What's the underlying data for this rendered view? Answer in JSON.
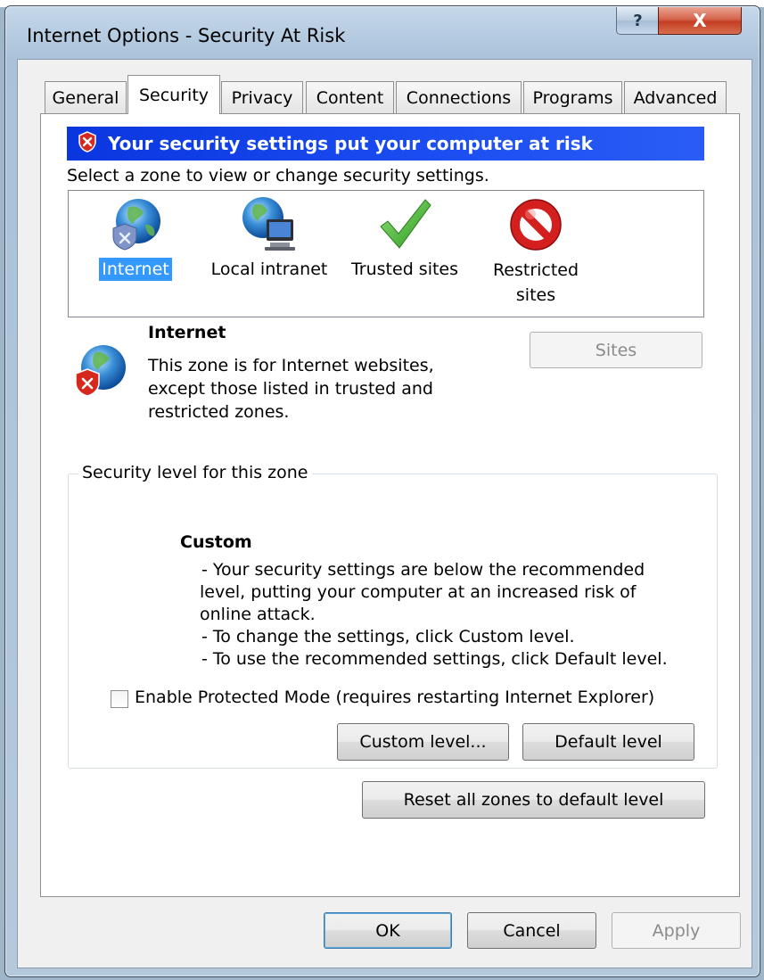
{
  "window": {
    "title": "Internet Options - Security At Risk",
    "help_glyph": "?",
    "close_glyph": "X"
  },
  "tabs": [
    {
      "label": "General"
    },
    {
      "label": "Security"
    },
    {
      "label": "Privacy"
    },
    {
      "label": "Content"
    },
    {
      "label": "Connections"
    },
    {
      "label": "Programs"
    },
    {
      "label": "Advanced"
    }
  ],
  "active_tab": "Security",
  "banner": {
    "text": "Your security settings put your computer at risk"
  },
  "zone_prompt": "Select a zone to view or change security settings.",
  "zones": [
    {
      "label": "Internet",
      "icon": "globe-shield-icon",
      "selected": true
    },
    {
      "label": "Local intranet",
      "icon": "globe-computer-icon",
      "selected": false
    },
    {
      "label": "Trusted sites",
      "icon": "green-check-icon",
      "selected": false
    },
    {
      "label": "Restricted",
      "label2": "sites",
      "icon": "no-entry-icon",
      "selected": false
    }
  ],
  "selected_zone": {
    "name": "Internet",
    "desc1": "This zone is for Internet websites,",
    "desc2": "except those listed in trusted and",
    "desc3": "restricted zones."
  },
  "sites_button": "Sites",
  "security_level": {
    "group_label": "Security level for this zone",
    "level": "Custom",
    "lines": [
      "- Your security settings are below the recommended",
      "level, putting your computer at an increased risk of",
      "online attack.",
      "- To change the settings, click Custom level.",
      "- To use the recommended settings, click Default level."
    ]
  },
  "protected_mode": {
    "label": "Enable Protected Mode (requires restarting Internet Explorer)",
    "checked": false
  },
  "buttons": {
    "custom_level": "Custom level...",
    "default_level": "Default level",
    "reset_all": "Reset all zones to default level",
    "ok": "OK",
    "cancel": "Cancel",
    "apply": "Apply"
  },
  "colors": {
    "banner_blue": "#1c4ef2",
    "selection_blue": "#3399ff",
    "close_red": "#c33d22"
  }
}
